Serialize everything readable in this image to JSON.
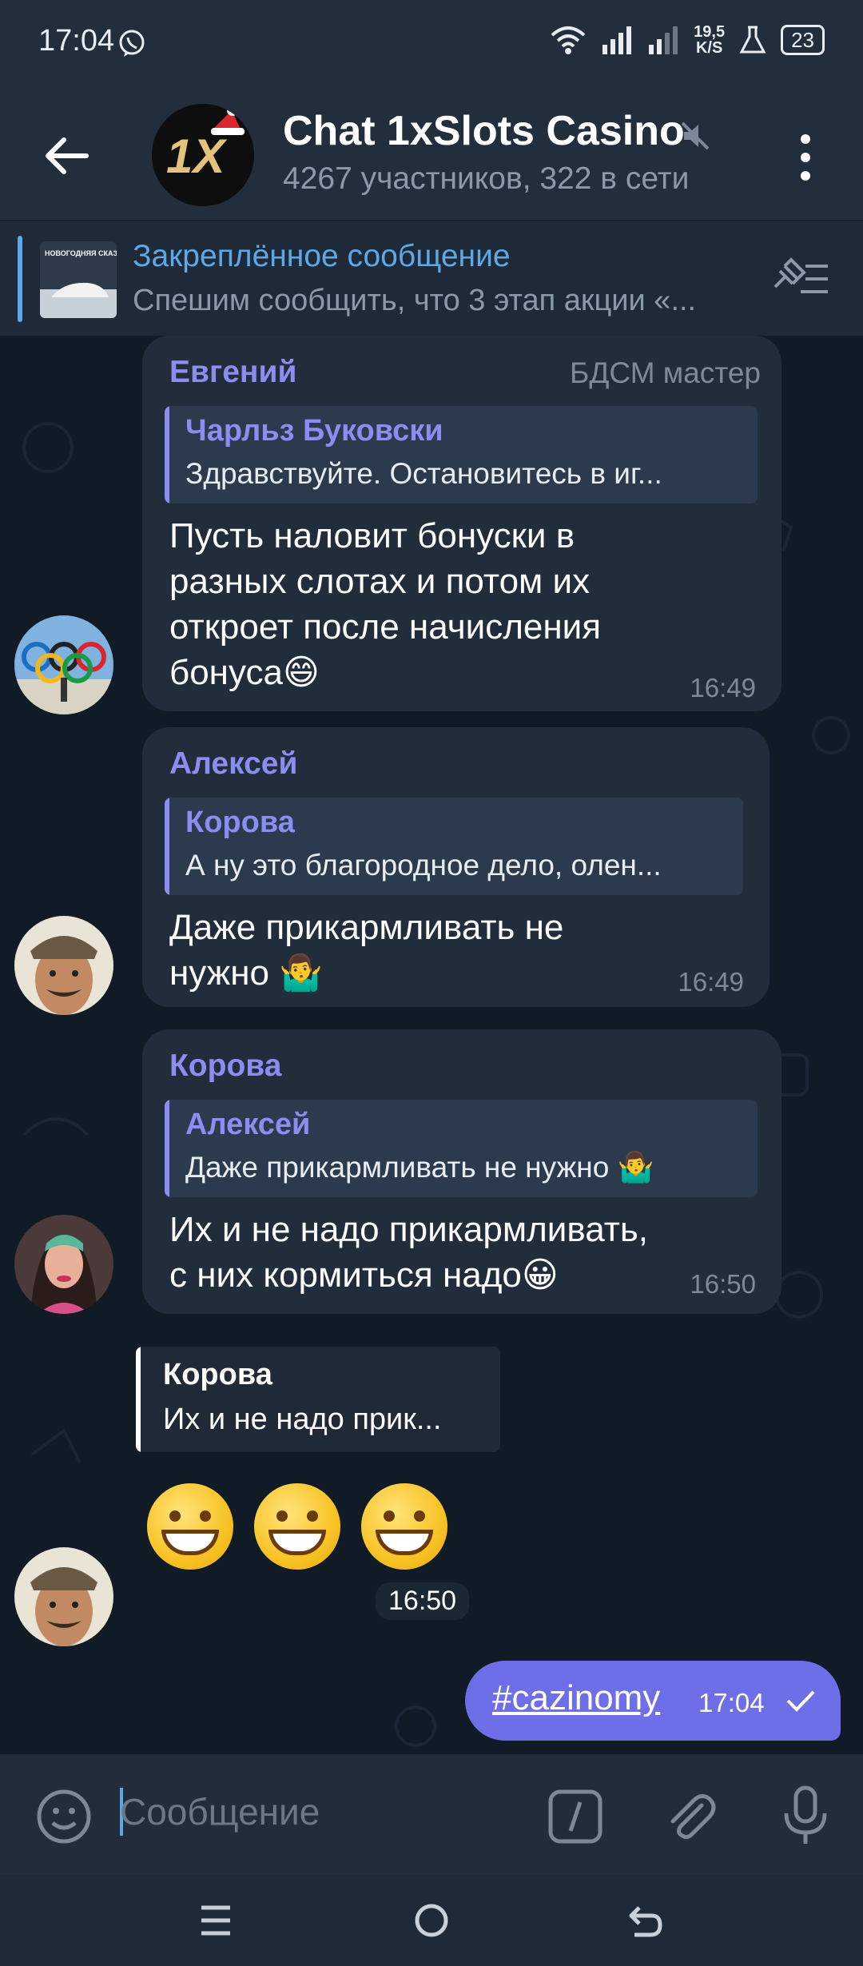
{
  "status_bar": {
    "time": "17:04",
    "net_speed_value": "19,5",
    "net_speed_unit": "K/S",
    "battery": "23"
  },
  "header": {
    "title": "Chat 1xSlots Casino",
    "subtitle": "4267 участников, 322 в сети",
    "avatar_text": "1X"
  },
  "pinned": {
    "title": "Закреплённое сообщение",
    "text": "Спешим сообщить, что 3 этап акции «...",
    "thumb_caption": "НОВОГОДНЯЯ СКАЗКА"
  },
  "messages": [
    {
      "sender": "Евгений",
      "rank": "БДСМ мастер",
      "reply_name": "Чарльз Буковски",
      "reply_text": "Здравствуйте. Остановитесь в иг...",
      "text": "Пусть наловит бонуски в\nразных слотах и потом их\nоткроет после начисления\nбонуса😄",
      "time": "16:49"
    },
    {
      "sender": "Алексей",
      "reply_name": "Корова",
      "reply_text": "А ну это благородное дело, олен...",
      "text": "Даже прикармливать не\nнужно 🤷‍♂️",
      "time": "16:49"
    },
    {
      "sender": "Корова",
      "reply_name": "Алексей",
      "reply_text": "Даже прикармливать не нужно 🤷‍♂️",
      "text": "Их и не надо прикармливать,\nс них кормиться надо😀",
      "time": "16:50"
    },
    {
      "reply_name": "Корова",
      "reply_text": "Их и не надо прик...",
      "time": "16:50"
    }
  ],
  "own_message": {
    "text": "#cazinomy",
    "time": "17:04"
  },
  "input": {
    "placeholder": "Сообщение"
  },
  "colors": {
    "accent": "#5ea8e6",
    "sender_name": "#8a8ef0",
    "own_bubble": "#6e6fe8",
    "bubble": "#212d3b"
  }
}
